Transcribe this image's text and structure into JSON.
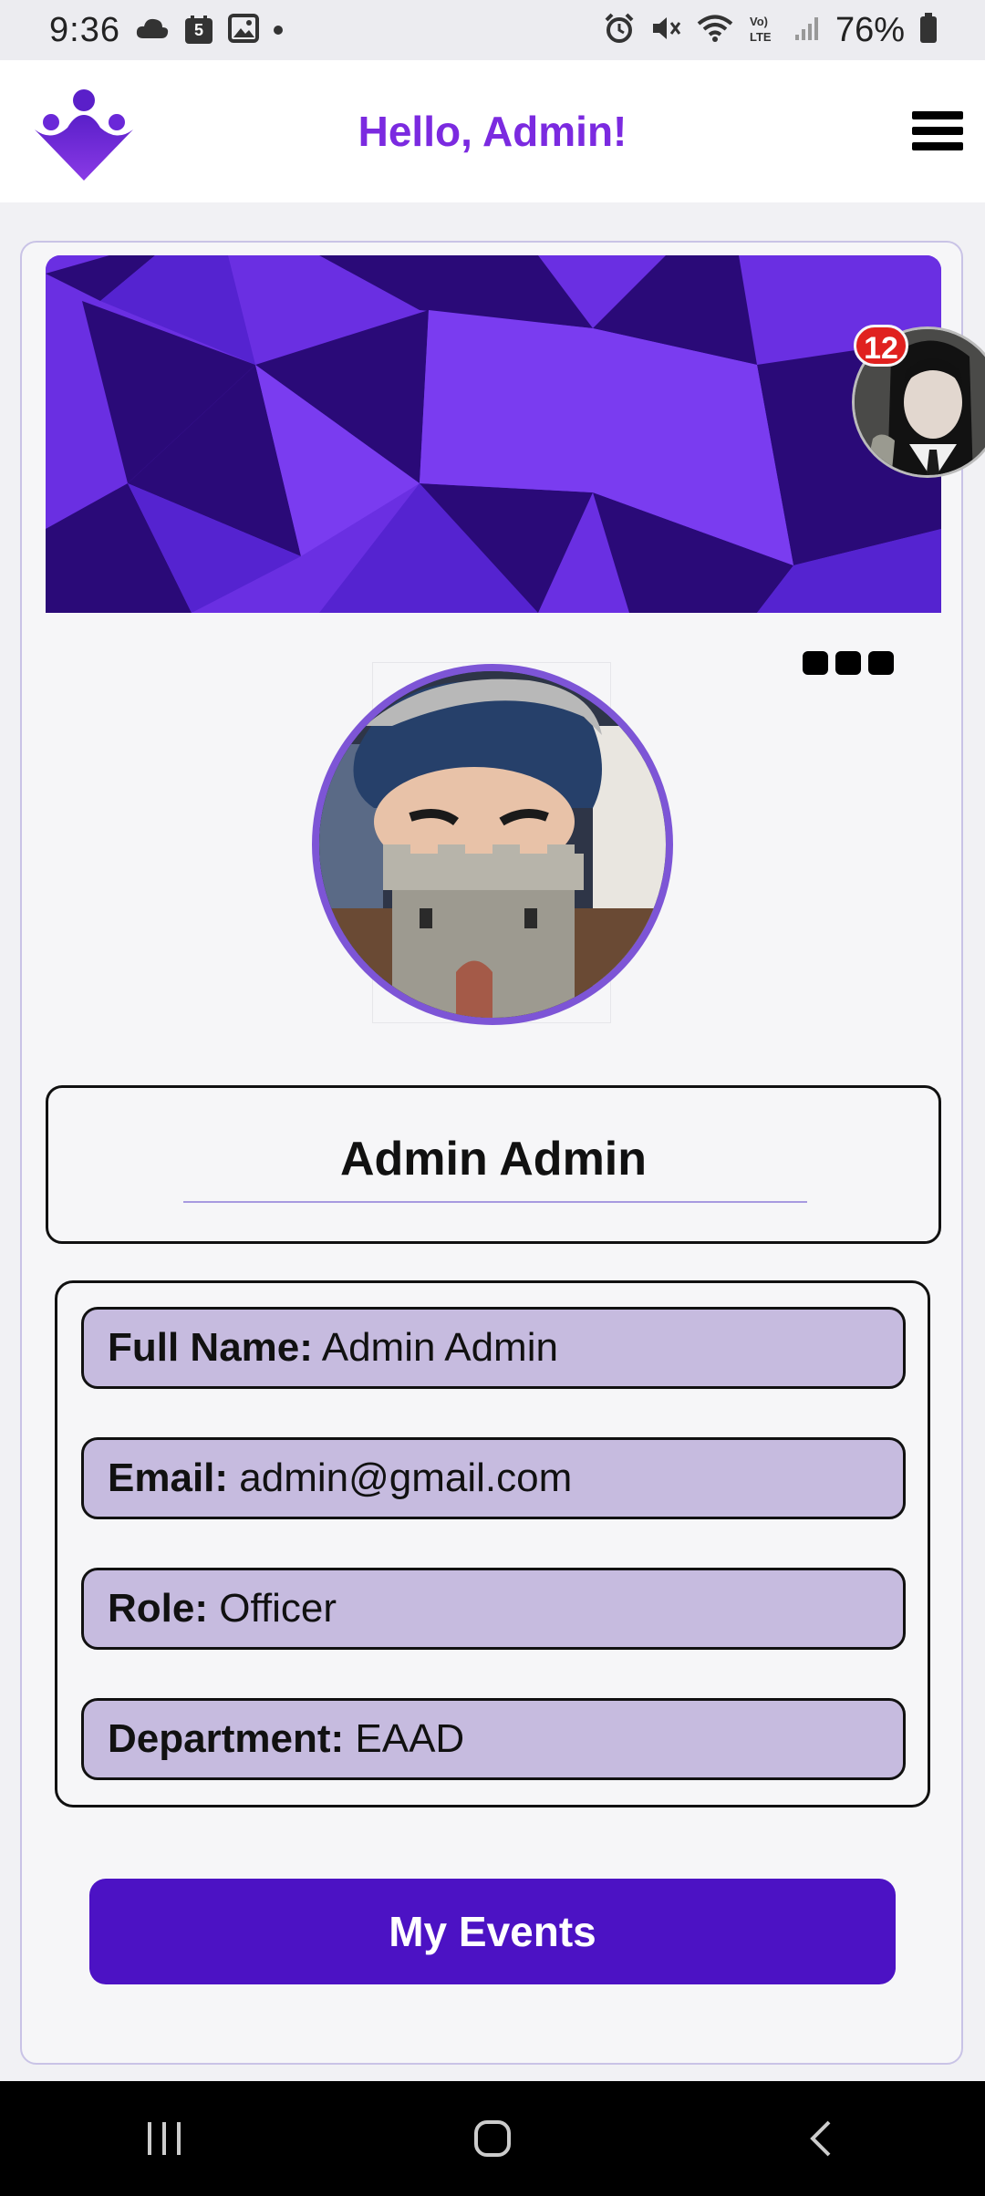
{
  "status_bar": {
    "time": "9:36",
    "notification_count": "5",
    "battery": "76%",
    "icons": [
      "cloud-icon",
      "calendar-icon",
      "gallery-icon",
      "alarm-icon",
      "mute-icon",
      "wifi-icon",
      "volte-icon",
      "signal-icon",
      "battery-icon"
    ]
  },
  "header": {
    "greeting": "Hello, Admin!",
    "brand_color": "#7b2ae0"
  },
  "notification": {
    "badge_count": "12",
    "badge_color": "#e0211f"
  },
  "profile": {
    "display_name": "Admin Admin",
    "fields": [
      {
        "label": "Full Name:",
        "value": "Admin Admin"
      },
      {
        "label": "Email:",
        "value": "admin@gmail.com"
      },
      {
        "label": "Role:",
        "value": "Officer"
      },
      {
        "label": "Department:",
        "value": "EAAD"
      }
    ]
  },
  "actions": {
    "events_button": "My Events",
    "events_button_color": "#4c12c4"
  },
  "colors": {
    "accent": "#7d55d6",
    "field_bg": "#c6bbdf",
    "banner_purple": "#6a2fe2",
    "banner_dark": "#2a0a78"
  }
}
